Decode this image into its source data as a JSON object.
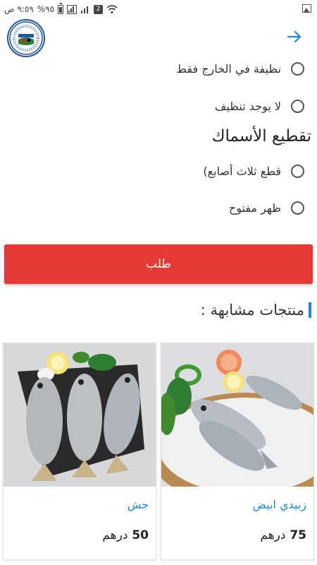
{
  "status_bar": {
    "time": "٩:٥٩ ص",
    "battery": "%٩٥",
    "sim": "2"
  },
  "header": {
    "logo_icon": "organization-seal-logo",
    "forward_icon": "arrow-right-icon",
    "accent_color": "#1e88e5"
  },
  "cleaning_options": [
    {
      "label": "نظيفة في الخارج فقط"
    },
    {
      "label": "لا يوجد تنظيف"
    }
  ],
  "cutting": {
    "title": "تقطيع الأسماك",
    "options": [
      {
        "label": "قطع ثلاث أصابع)"
      },
      {
        "label": "ظهر مفتوح"
      }
    ]
  },
  "order_button": {
    "label": "طلب",
    "color": "#e53935"
  },
  "similar": {
    "title": "منتجات مشابهة :",
    "products": [
      {
        "name": "زبيدي ابيض",
        "price": "75",
        "currency": "درهم"
      },
      {
        "name": "جش",
        "price": "50",
        "currency": "درهم"
      }
    ]
  }
}
